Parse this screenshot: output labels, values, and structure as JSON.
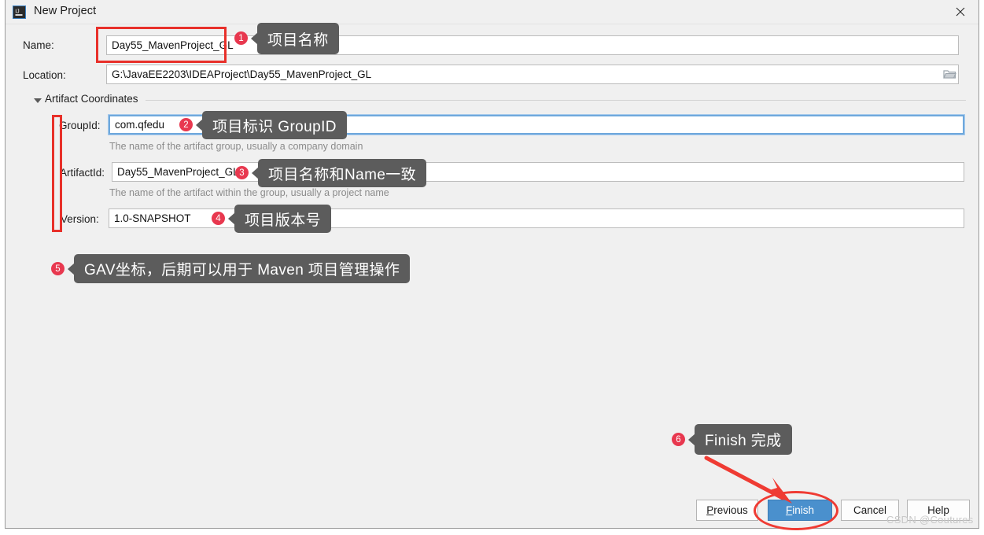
{
  "window": {
    "title": "New Project",
    "icon": "intellij-idea-icon",
    "close_label": "✕"
  },
  "form": {
    "name_label": "Name:",
    "name_value": "Day55_MavenProject_GL",
    "location_label": "Location:",
    "location_value": "G:\\JavaEE2203\\IDEAProject\\Day55_MavenProject_GL",
    "browse_icon": "folder-icon",
    "section_label": "Artifact Coordinates",
    "groupid_label": "GroupId:",
    "groupid_value": "com.qfedu",
    "groupid_hint": "The name of the artifact group, usually a company domain",
    "artifactid_label": "ArtifactId:",
    "artifactid_value": "Day55_MavenProject_GL",
    "artifactid_hint": "The name of the artifact within the group, usually a project name",
    "version_label": "Version:",
    "version_value": "1.0-SNAPSHOT"
  },
  "buttons": {
    "previous": "Previous",
    "previous_mnemonic": "P",
    "finish": "Finish",
    "finish_mnemonic": "F",
    "cancel": "Cancel",
    "help": "Help"
  },
  "annotations": [
    {
      "number": "1",
      "text": "项目名称"
    },
    {
      "number": "2",
      "text": "项目标识 GroupID"
    },
    {
      "number": "3",
      "text": "项目名称和Name一致"
    },
    {
      "number": "4",
      "text": "项目版本号"
    },
    {
      "number": "5",
      "text": "GAV坐标，后期可以用于 Maven 项目管理操作"
    },
    {
      "number": "6",
      "text": "Finish 完成"
    }
  ],
  "watermark": "CSDN @Coutures",
  "colors": {
    "annotation_red": "#e8384f",
    "highlight_red": "#e8302a",
    "tooltip_gray": "#5c5c5c",
    "primary_blue": "#4a90cd",
    "dialog_bg": "#f0f0f0"
  }
}
